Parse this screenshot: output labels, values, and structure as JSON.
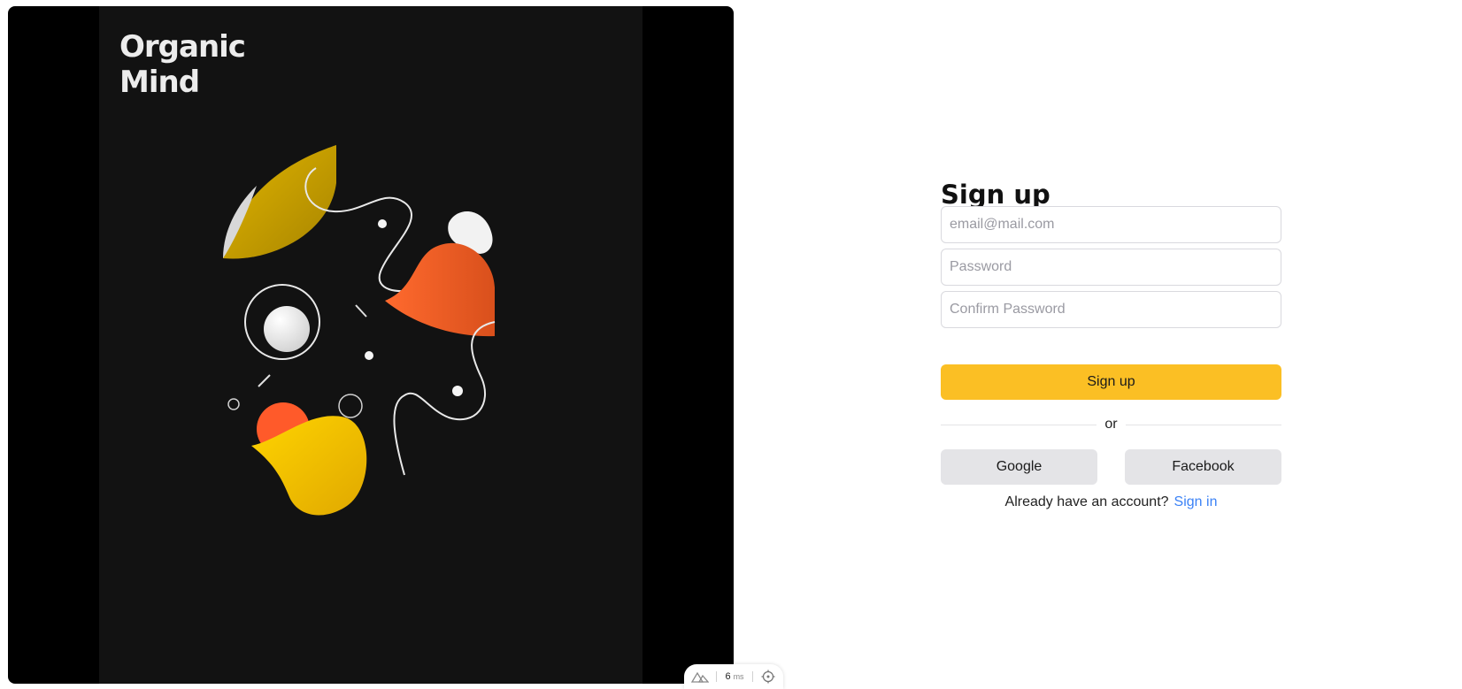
{
  "hero": {
    "poster_title_line1": "Organic",
    "poster_title_line2": "Mind"
  },
  "form": {
    "title": "Sign up",
    "email_placeholder": "email@mail.com",
    "password_placeholder": "Password",
    "confirm_placeholder": "Confirm Password",
    "submit_label": "Sign up",
    "divider_text": "or",
    "google_label": "Google",
    "facebook_label": "Facebook",
    "footer_text": "Already have an account?",
    "signin_link": "Sign in"
  },
  "devbar": {
    "timing_value": "6",
    "timing_unit": "ms",
    "logo_icon": "nuxt-logo-icon",
    "inspect_icon": "crosshair-icon"
  },
  "colors": {
    "accent": "#fbbf24",
    "link": "#3b82f6",
    "poster_bg": "#121212"
  }
}
